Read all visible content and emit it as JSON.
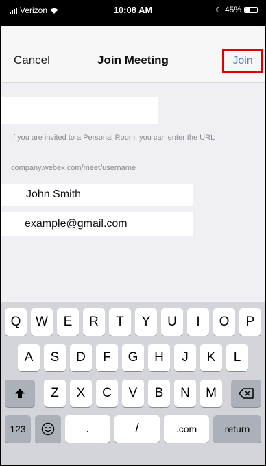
{
  "status_bar": {
    "carrier": "Verizon",
    "time": "10:08 AM",
    "battery": "45%",
    "battery_level": 0.45
  },
  "nav": {
    "cancel_label": "Cancel",
    "title": "Join Meeting",
    "join_label": "Join"
  },
  "form": {
    "meeting_field_value": "",
    "hint": "If you are invited to a Personal Room, you can enter the URL",
    "url_hint": "company.webex.com/meet/username",
    "name_value": "John Smith",
    "email_value": "example@gmail.com"
  },
  "keyboard": {
    "row1": [
      "Q",
      "W",
      "E",
      "R",
      "T",
      "Y",
      "U",
      "I",
      "O",
      "P"
    ],
    "row2": [
      "A",
      "S",
      "D",
      "F",
      "G",
      "H",
      "J",
      "K",
      "L"
    ],
    "row3": [
      "Z",
      "X",
      "C",
      "V",
      "B",
      "N",
      "M"
    ],
    "numbers_key": "123",
    "dot_key": ".",
    "slash_key": "/",
    "dotcom_key": ".com",
    "return_key": "return"
  },
  "colors": {
    "accent": "#4a86d4",
    "highlight_border": "#e00000"
  }
}
